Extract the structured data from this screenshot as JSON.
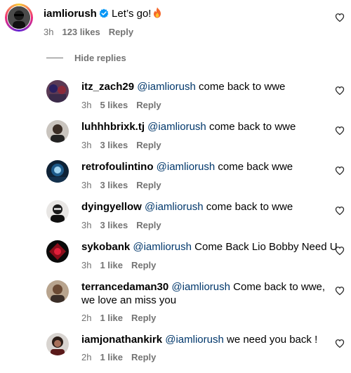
{
  "main_comment": {
    "username": "iamliorush",
    "text": "Let’s go!",
    "time": "3h",
    "likes": "123 likes",
    "reply": "Reply"
  },
  "hide_replies": "Hide replies",
  "replies": [
    {
      "username": "itz_zach29",
      "mention": "@iamliorush",
      "text": "come back to wwe",
      "time": "3h",
      "likes": "5 likes",
      "reply": "Reply"
    },
    {
      "username": "luhhhbrixk.tj",
      "mention": "@iamliorush",
      "text": "come back to wwe",
      "time": "3h",
      "likes": "3 likes",
      "reply": "Reply"
    },
    {
      "username": "retrofoulintino",
      "mention": "@iamliorush",
      "text": "come back wwe",
      "time": "3h",
      "likes": "3 likes",
      "reply": "Reply"
    },
    {
      "username": "dyingyellow",
      "mention": "@iamliorush",
      "text": "come back to wwe",
      "time": "3h",
      "likes": "3 likes",
      "reply": "Reply"
    },
    {
      "username": "sykobank",
      "mention": "@iamliorush",
      "text": "Come Back Lio Bobby Need U",
      "time": "3h",
      "likes": "1 like",
      "reply": "Reply"
    },
    {
      "username": "terrancedaman30",
      "mention": "@iamliorush",
      "text": "Come back to wwe,",
      "text2": "we love an miss you",
      "time": "2h",
      "likes": "1 like",
      "reply": "Reply"
    },
    {
      "username": "iamjonathankirk",
      "mention": "@iamliorush",
      "text": "we need you back !",
      "time": "2h",
      "likes": "1 like",
      "reply": "Reply"
    }
  ],
  "colors": {
    "text": "#000000",
    "mention": "#00376b",
    "meta": "#737373",
    "verified": "#0095f6"
  },
  "icons": {
    "like": "heart-outline-icon",
    "verified": "verified-badge-icon",
    "emoji": "fire-emoji-icon"
  }
}
